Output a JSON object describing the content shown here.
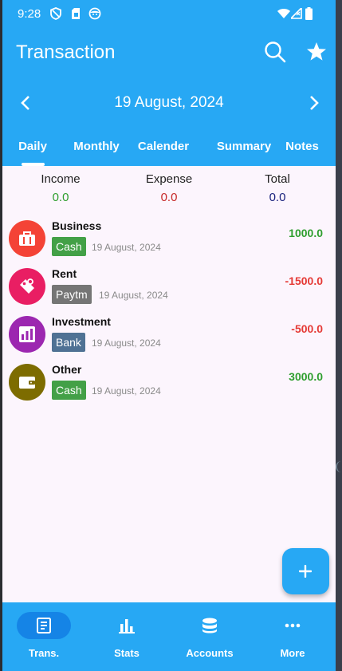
{
  "status_bar": {
    "time": "9:28"
  },
  "header": {
    "title": "Transaction",
    "date": "19 August, 2024"
  },
  "tabs": [
    {
      "label": "Daily",
      "active": true
    },
    {
      "label": "Monthly",
      "active": false
    },
    {
      "label": "Calender",
      "active": false
    },
    {
      "label": "Summary",
      "active": false
    },
    {
      "label": "Notes",
      "active": false
    }
  ],
  "summary": {
    "income": {
      "label": "Income",
      "value": "0.0",
      "color": "#2e9e2e"
    },
    "expense": {
      "label": "Expense",
      "value": "0.0",
      "color": "#c62828"
    },
    "total": {
      "label": "Total",
      "value": "0.0",
      "color": "#1a237e"
    }
  },
  "transactions": [
    {
      "name": "Business",
      "account": "Cash",
      "account_color": "#43a047",
      "date": "19 August, 2024",
      "amount": "1000.0",
      "amount_color": "#2e9e2e",
      "icon": "briefcase-icon",
      "icon_color": "#f44336"
    },
    {
      "name": "Rent",
      "account": "Paytm",
      "account_color": "#757575",
      "date": "19 August, 2024",
      "amount": "-1500.0",
      "amount_color": "#e53935",
      "icon": "key-tag-icon",
      "icon_color": "#e91e63"
    },
    {
      "name": "Investment",
      "account": "Bank",
      "account_color": "#4f7194",
      "date": "19 August, 2024",
      "amount": "-500.0",
      "amount_color": "#e53935",
      "icon": "bar-chart-icon",
      "icon_color": "#9c27b0"
    },
    {
      "name": "Other",
      "account": "Cash",
      "account_color": "#43a047",
      "date": "19 August, 2024",
      "amount": "3000.0",
      "amount_color": "#2e9e2e",
      "icon": "wallet-icon",
      "icon_color": "#7d6c00"
    }
  ],
  "bottom_nav": [
    {
      "label": "Trans.",
      "icon": "receipt-icon",
      "active": true
    },
    {
      "label": "Stats",
      "icon": "stats-icon",
      "active": false
    },
    {
      "label": "Accounts",
      "icon": "database-icon",
      "active": false
    },
    {
      "label": "More",
      "icon": "more-horizontal-icon",
      "active": false
    }
  ],
  "colors": {
    "primary": "#27a8f4",
    "background": "#fcf5fd",
    "nav_pill": "#1584e6"
  }
}
